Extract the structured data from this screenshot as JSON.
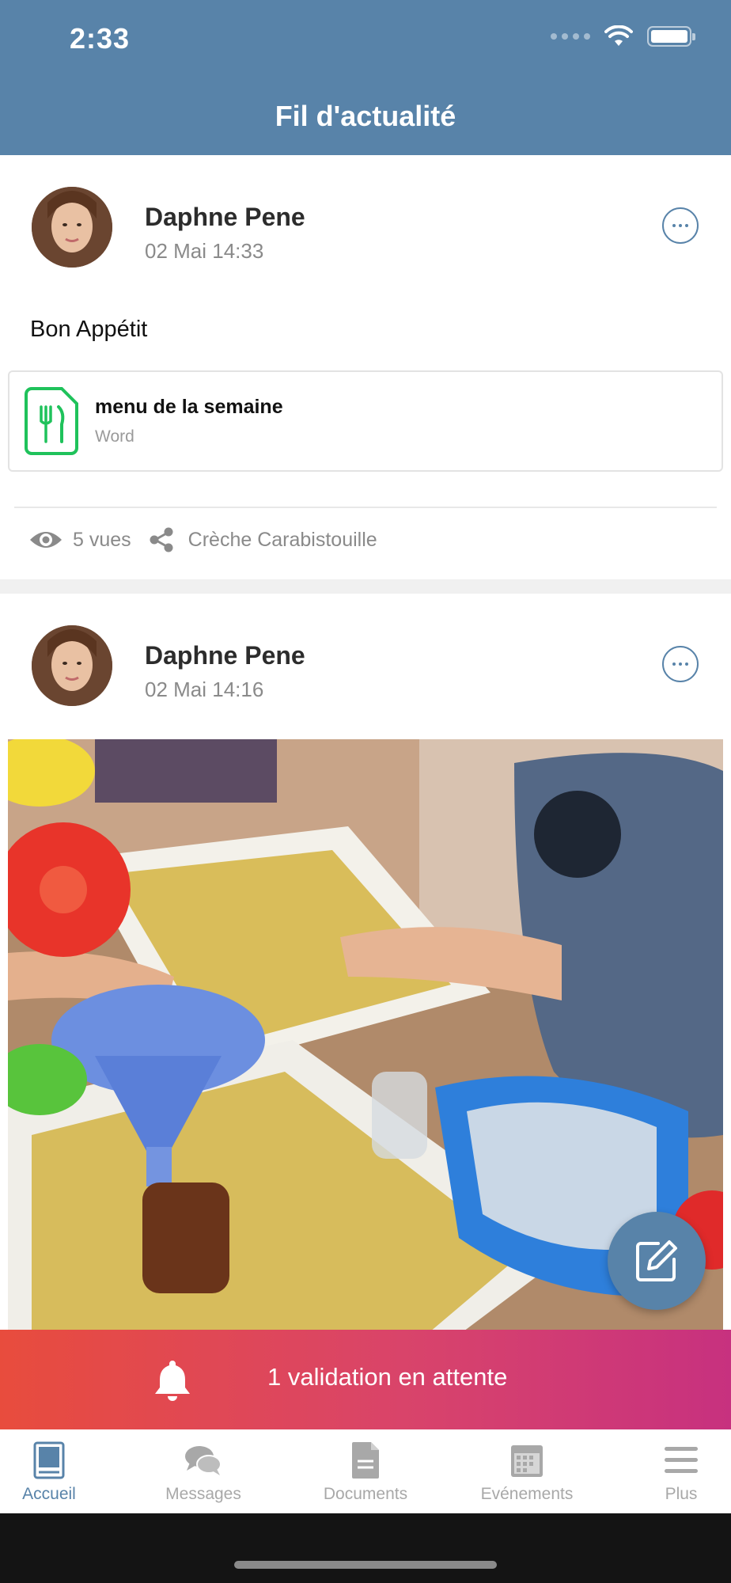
{
  "status_bar": {
    "time": "2:33"
  },
  "header": {
    "title": "Fil d'actualité"
  },
  "posts": [
    {
      "author": "Daphne Pene",
      "date": "02 Mai 14:33",
      "text": "Bon Appétit",
      "attachment": {
        "name": "menu de la semaine",
        "type": "Word",
        "icon": "fork-knife-document-icon"
      },
      "views": "5 vues",
      "group": "Crèche Carabistouille"
    },
    {
      "author": "Daphne Pene",
      "date": "02 Mai 14:16",
      "image": "children playing with semolina trays and funnel"
    }
  ],
  "banner": {
    "text": "1 validation en attente",
    "icon": "bell-icon"
  },
  "tabs": [
    {
      "label": "Accueil",
      "icon": "home-book-icon",
      "active": true
    },
    {
      "label": "Messages",
      "icon": "chat-bubbles-icon",
      "active": false
    },
    {
      "label": "Documents",
      "icon": "document-icon",
      "active": false
    },
    {
      "label": "Evénements",
      "icon": "calendar-icon",
      "active": false
    },
    {
      "label": "Plus",
      "icon": "menu-icon",
      "active": false
    }
  ],
  "colors": {
    "header": "#5883a9",
    "accent": "#5883a9",
    "attachment_icon": "#1fc25b",
    "banner_start": "#e84c3d",
    "banner_end": "#c7317f"
  }
}
